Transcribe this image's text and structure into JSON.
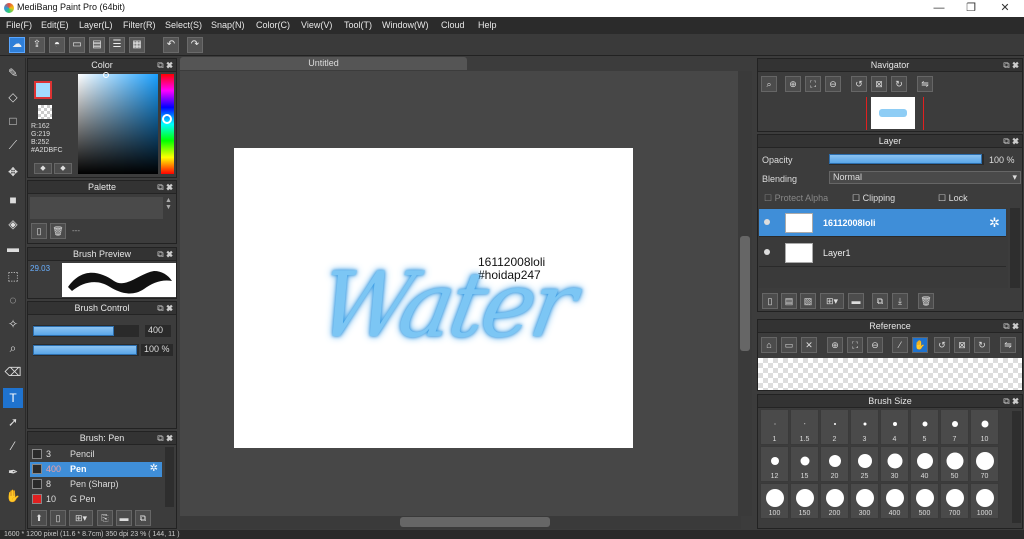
{
  "app": {
    "title": "MediBang Paint Pro (64bit)"
  },
  "window_controls": {
    "minimize": "—",
    "maximize": "❐",
    "close": "✕"
  },
  "menu": [
    "File(F)",
    "Edit(E)",
    "Layer(L)",
    "Filter(R)",
    "Select(S)",
    "Snap(N)",
    "Color(C)",
    "View(V)",
    "Tool(T)",
    "Window(W)",
    "Cloud",
    "Help"
  ],
  "toolbar": {
    "icons": [
      "cloud-icon",
      "share-icon",
      "comment-icon",
      "chat-icon",
      "page-icon",
      "list-icon",
      "grid-icon",
      "undo-icon",
      "redo-icon"
    ]
  },
  "document": {
    "tab_title": "Untitled"
  },
  "canvas_text": {
    "line1": "16112008loli",
    "line2": "#hoidap247",
    "art_word": "Water"
  },
  "color_panel": {
    "title": "Color",
    "r_label": "R:162",
    "g_label": "G:219",
    "b_label": "B:252",
    "hex": "#A2DBFC",
    "primary": "#A2DBFC"
  },
  "palette_panel": {
    "title": "Palette",
    "field": "---"
  },
  "brush_preview_panel": {
    "title": "Brush Preview",
    "size_label": "29.03"
  },
  "brush_control_panel": {
    "title": "Brush Control",
    "size_value": "400",
    "size_fraction": 0.78,
    "opacity_value": "100 %",
    "opacity_fraction": 1.0
  },
  "brush_list_panel": {
    "title": "Brush: Pen",
    "brushes": [
      {
        "size": "3",
        "name": "Pencil",
        "selected": false,
        "color": "#2a2a2a"
      },
      {
        "size": "400",
        "name": "Pen",
        "selected": true,
        "color": "#2a2a2a"
      },
      {
        "size": "8",
        "name": "Pen (Sharp)",
        "selected": false,
        "color": "#2a2a2a"
      },
      {
        "size": "10",
        "name": "G Pen",
        "selected": false,
        "color": "#e02020"
      }
    ]
  },
  "navigator_panel": {
    "title": "Navigator"
  },
  "layer_panel": {
    "title": "Layer",
    "opacity_label": "Opacity",
    "opacity_value": "100 %",
    "opacity_fraction": 1.0,
    "blending_label": "Blending",
    "blending_value": "Normal",
    "protect_alpha": "Protect Alpha",
    "clipping": "Clipping",
    "lock": "Lock",
    "layers": [
      {
        "name": "16112008loli",
        "selected": true
      },
      {
        "name": "Layer1",
        "selected": false
      }
    ]
  },
  "reference_panel": {
    "title": "Reference"
  },
  "brush_size_panel": {
    "title": "Brush Size",
    "sizes": [
      "1",
      "1.5",
      "2",
      "3",
      "4",
      "5",
      "7",
      "10",
      "12",
      "15",
      "20",
      "25",
      "30",
      "40",
      "50",
      "70",
      "100",
      "150",
      "200",
      "300",
      "400",
      "500",
      "700",
      "1000"
    ]
  },
  "status": {
    "text": "1600 * 1200 pixel   (11.6 * 8.7cm)   350 dpi   23 %   ( 144, 11 )"
  }
}
